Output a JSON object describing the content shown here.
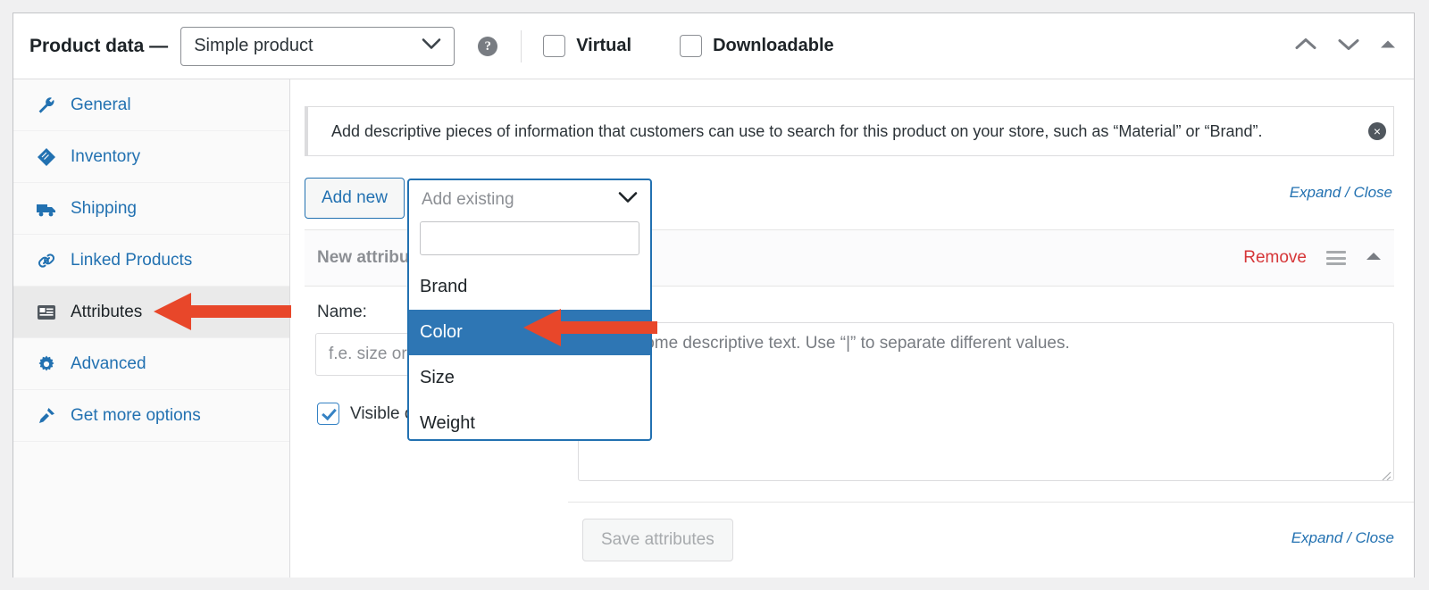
{
  "header": {
    "title": "Product data —",
    "product_type": "Simple product",
    "help_icon": "help-icon",
    "checkboxes": [
      {
        "label": "Virtual",
        "checked": false
      },
      {
        "label": "Downloadable",
        "checked": false
      }
    ],
    "controls": [
      {
        "name": "move-up-icon",
        "glyph": "chevron-up"
      },
      {
        "name": "move-down-icon",
        "glyph": "chevron-down"
      },
      {
        "name": "toggle-panel-icon",
        "glyph": "triangle-up"
      }
    ]
  },
  "sidebar": {
    "items": [
      {
        "label": "General",
        "icon": "wrench-icon",
        "active": false
      },
      {
        "label": "Inventory",
        "icon": "tag-icon",
        "active": false
      },
      {
        "label": "Shipping",
        "icon": "truck-icon",
        "active": false
      },
      {
        "label": "Linked Products",
        "icon": "link-icon",
        "active": false
      },
      {
        "label": "Attributes",
        "icon": "list-box-icon",
        "active": true
      },
      {
        "label": "Advanced",
        "icon": "gear-icon",
        "active": false
      },
      {
        "label": "Get more options",
        "icon": "plug-icon",
        "active": false
      }
    ]
  },
  "notice": {
    "text": "Add descriptive pieces of information that customers can use to search for this product on your store, such as “Material” or “Brand”.",
    "close_icon": "dismiss-icon"
  },
  "toolbar": {
    "add_new_label": "Add new",
    "expand_label": "Expand",
    "separator": " / ",
    "close_label": "Close"
  },
  "dropdown": {
    "placeholder": "Add existing",
    "search_value": "",
    "chevron_icon": "chevron-down-icon",
    "options": [
      {
        "label": "Brand",
        "selected": false
      },
      {
        "label": "Color",
        "selected": true
      },
      {
        "label": "Size",
        "selected": false
      },
      {
        "label": "Weight",
        "selected": false
      }
    ]
  },
  "attribute_row": {
    "title": "New attribute",
    "remove_label": "Remove",
    "drag_icon": "drag-handle-icon",
    "collapse_icon": "triangle-up-icon",
    "name_label": "Name:",
    "name_placeholder": "f.e. size or color",
    "value_placeholder": "Enter some descriptive text. Use “|” to separate different values.",
    "visible_label": "Visible on the product page",
    "visible_checked": true
  },
  "footer": {
    "save_label": "Save attributes",
    "save_disabled": true,
    "expand_label": "Expand",
    "separator": " / ",
    "close_label": "Close"
  },
  "annotations": [
    {
      "name": "arrow-to-attributes-tab",
      "color": "#e8472a"
    },
    {
      "name": "arrow-to-color-option",
      "color": "#e8472a"
    }
  ],
  "colors": {
    "accent_blue": "#2271b1",
    "selected_blue": "#2e76b4",
    "annotation_red": "#e8472a",
    "remove_red": "#d63638"
  }
}
